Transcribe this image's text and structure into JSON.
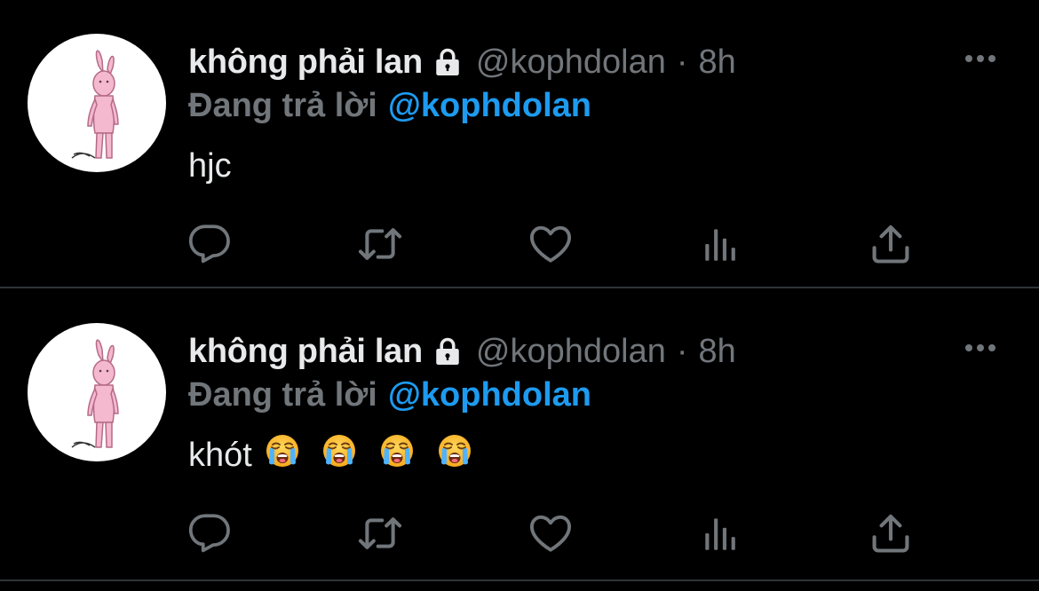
{
  "colors": {
    "background": "#000000",
    "divider": "#2f3336",
    "primary_text": "#e7e9ea",
    "secondary_text": "#71767b",
    "link": "#1d9bf0",
    "avatar_bunny": "#f4b8cf"
  },
  "tweets": [
    {
      "author_name": "không phải lan",
      "protected_icon": "lock-icon",
      "handle": "@kophdolan",
      "separator": "·",
      "time": "8h",
      "reply_label": "Đang trả lời",
      "reply_to": "@kophdolan",
      "text": "hjc",
      "emojis": [],
      "actions": [
        "reply-icon",
        "retweet-icon",
        "like-icon",
        "views-icon",
        "share-icon"
      ]
    },
    {
      "author_name": "không phải lan",
      "protected_icon": "lock-icon",
      "handle": "@kophdolan",
      "separator": "·",
      "time": "8h",
      "reply_label": "Đang trả lời",
      "reply_to": "@kophdolan",
      "text": "khót",
      "emojis": [
        "loudly-crying-face",
        "loudly-crying-face",
        "loudly-crying-face",
        "loudly-crying-face"
      ],
      "actions": [
        "reply-icon",
        "retweet-icon",
        "like-icon",
        "views-icon",
        "share-icon"
      ]
    }
  ]
}
